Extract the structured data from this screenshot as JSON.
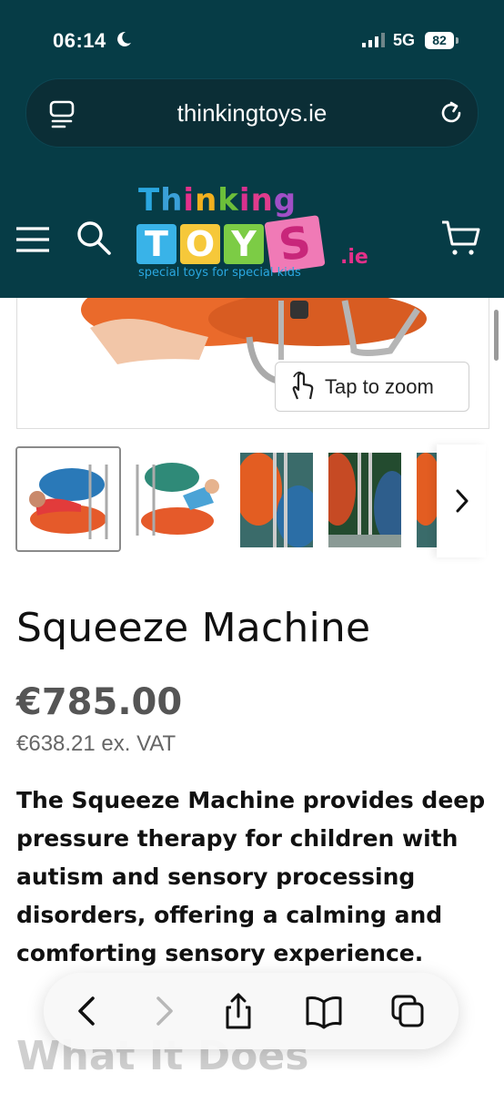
{
  "status_bar": {
    "time": "06:14",
    "network": "5G",
    "battery": "82"
  },
  "browser": {
    "url": "thinkingtoys.ie"
  },
  "site": {
    "logo": {
      "thinking": [
        "T",
        "h",
        "i",
        "n",
        "k",
        "i",
        "n",
        "g"
      ],
      "toys_letters": [
        "T",
        "O",
        "Y",
        "S"
      ],
      "toys_colors": [
        "#2aa7e0",
        "#f2b01e",
        "#6cbf3a",
        "#e4308a"
      ],
      "domain": ".ie",
      "tagline": "special toys for special kids"
    },
    "brand_color": "#063c46"
  },
  "gallery": {
    "zoom_label": "Tap to zoom",
    "thumbnail_count": 5,
    "selected_index": 0
  },
  "product": {
    "title": "Squeeze Machine",
    "price": "€785.00",
    "price_ex_vat": "€638.21 ex. VAT",
    "description": "The Squeeze Machine provides deep pressure therapy for children with autism and sensory processing disorders, offering a calming and comforting sensory experience.",
    "next_section": "What It Does"
  },
  "toolbar": {
    "icons": [
      "back-icon",
      "forward-icon",
      "share-icon",
      "bookmarks-icon",
      "tabs-icon"
    ]
  }
}
